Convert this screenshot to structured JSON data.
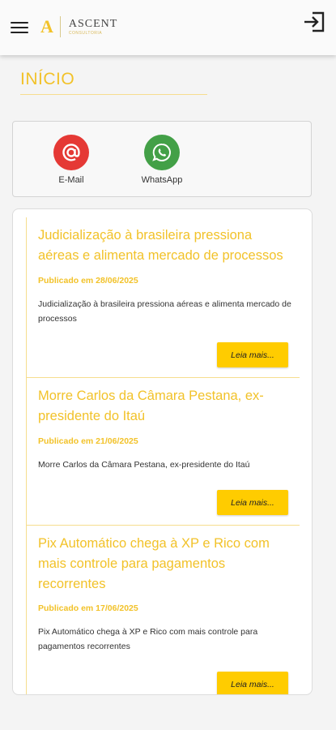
{
  "header": {
    "logo_letter": "A",
    "brand_name": "ASCENT",
    "brand_sub": "CONSULTORIA",
    "menu_icon": "hamburger-menu-icon",
    "logout_icon": "logout-icon"
  },
  "page": {
    "title": "INÍCIO"
  },
  "contacts": [
    {
      "label": "E-Mail",
      "icon": "at-sign-icon",
      "color": "#e53935"
    },
    {
      "label": "WhatsApp",
      "icon": "whatsapp-icon",
      "color": "#43a047"
    }
  ],
  "colors": {
    "accent": "#f2c229",
    "button": "#ffcc00"
  },
  "news": [
    {
      "title": "Judicialização à brasileira pressiona aéreas e alimenta mercado de processos",
      "date": "Publicado em 28/06/2025",
      "description": "Judicialização à brasileira pressiona aéreas e alimenta mercado de processos",
      "button": "Leia mais..."
    },
    {
      "title": "Morre Carlos da Câmara Pestana, ex-presidente do Itaú",
      "date": "Publicado em 21/06/2025",
      "description": "Morre Carlos da Câmara Pestana, ex-presidente do Itaú",
      "button": "Leia mais..."
    },
    {
      "title": "Pix Automático chega à XP e Rico com mais controle para pagamentos recorrentes",
      "date": "Publicado em 17/06/2025",
      "description": "Pix Automático chega à XP e Rico com mais controle para pagamentos recorrentes",
      "button": "Leia mais..."
    }
  ]
}
